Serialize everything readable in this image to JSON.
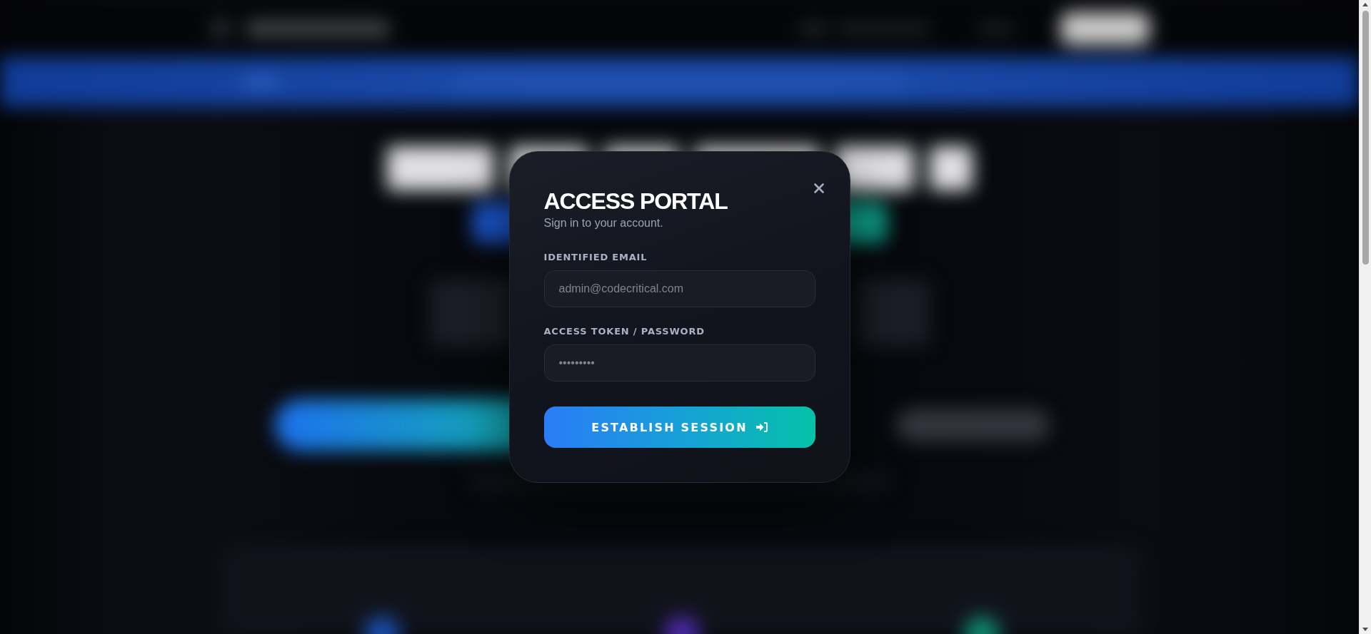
{
  "dialog": {
    "title": "ACCESS PORTAL",
    "subtitle": "Sign in to your account.",
    "fields": [
      {
        "label": "IDENTIFIED EMAIL",
        "placeholder": "admin@codecritical.com"
      },
      {
        "label": "ACCESS TOKEN / PASSWORD",
        "placeholder": "•••••••••"
      }
    ],
    "submit": {
      "label": "ESTABLISH SESSION"
    }
  }
}
